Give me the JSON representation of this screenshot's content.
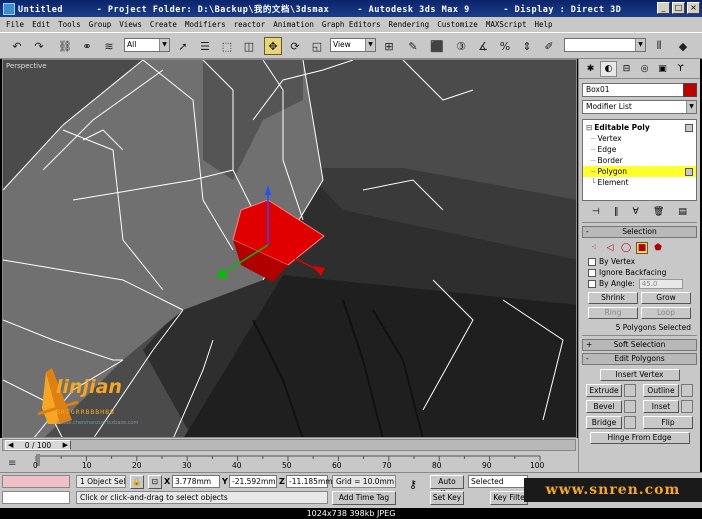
{
  "window": {
    "title": "Untitled      - Project Folder: D:\\Backup\\我的文档\\3dsmax     - Autodesk 3ds Max 9      - Display : Direct 3D",
    "buttons": [
      "_",
      "□",
      "×"
    ]
  },
  "menubar": [
    "File",
    "Edit",
    "Tools",
    "Group",
    "Views",
    "Create",
    "Modifiers",
    "reactor",
    "Animation",
    "Graph Editors",
    "Rendering",
    "Customize",
    "MAXScript",
    "Help"
  ],
  "toolbar": {
    "selection_filter": "All",
    "reference_coord": "View"
  },
  "viewport": {
    "label": "Perspective"
  },
  "logo": {
    "text": "linjian",
    "sub": "BRIGRRBBBHBB",
    "url": "aaaaa.chenmanzuo.foxbase.com"
  },
  "command_panel": {
    "object_name": "Box01",
    "modifier_list": "Modifier List",
    "stack": [
      {
        "label": "Editable Poly",
        "level": "top"
      },
      {
        "label": "Vertex",
        "level": "sub"
      },
      {
        "label": "Edge",
        "level": "sub"
      },
      {
        "label": "Border",
        "level": "sub"
      },
      {
        "label": "Polygon",
        "level": "sub",
        "selected": true
      },
      {
        "label": "Element",
        "level": "sub"
      }
    ],
    "selection": {
      "title": "Selection",
      "by_vertex": "By Vertex",
      "ignore_backfacing": "Ignore Backfacing",
      "by_angle": "By Angle:",
      "angle_value": "45.0",
      "shrink": "Shrink",
      "grow": "Grow",
      "ring": "Ring",
      "loop": "Loop",
      "status": "5 Polygons Selected"
    },
    "soft_selection": "Soft Selection",
    "edit_polygons": {
      "title": "Edit Polygons",
      "insert_vertex": "Insert Vertex",
      "extrude": "Extrude",
      "outline": "Outline",
      "bevel": "Bevel",
      "inset": "Inset",
      "bridge": "Bridge",
      "flip": "Flip",
      "hinge": "Hinge From Edge"
    }
  },
  "timeline": {
    "frame": "0 / 100",
    "ticks": [
      "0",
      "10",
      "20",
      "30",
      "40",
      "50",
      "60",
      "70",
      "80",
      "90",
      "100"
    ]
  },
  "status": {
    "selected_count": "1 Object Sele",
    "prompt": "Click or click-and-drag to select objects",
    "x_label": "X",
    "x_value": "3.778mm",
    "y_label": "Y",
    "y_value": "-21.592mm",
    "z_label": "Z",
    "z_value": "-11.185mm",
    "grid": "Grid = 10.0mm",
    "add_time_tag": "Add Time Tag",
    "auto_key": "Auto Key",
    "set_key": "Set Key",
    "key_mode": "Selected",
    "key_filters": "Key Filte"
  },
  "watermark": "www.snren.com",
  "caption": "1024x738  398kb  JPEG"
}
